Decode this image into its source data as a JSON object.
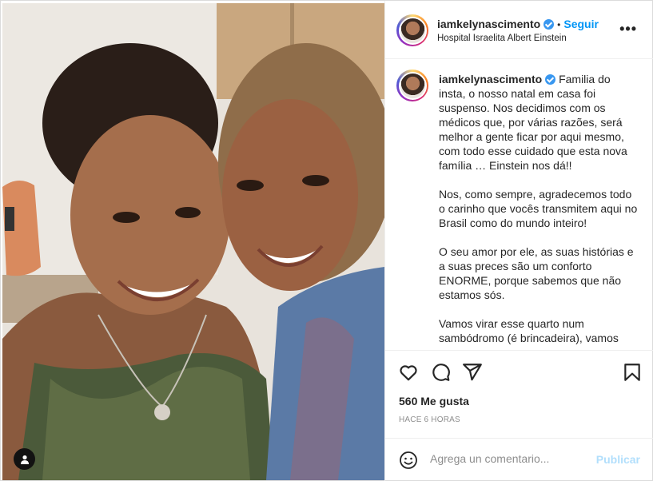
{
  "post": {
    "username": "iamkelynascimento",
    "follow_label": "Seguir",
    "separator": "•",
    "location": "Hospital Israelita Albert Einstein",
    "more_label": "•••",
    "caption": {
      "username": "iamkelynascimento",
      "paragraphs": [
        "Familia do insta, o nosso natal em casa foi suspenso. Nos decidimos com os médicos que, por várias razões, será melhor a gente ficar por aqui mesmo, com todo esse cuidado que esta nova família … Einstein nos dá!!",
        "Nos, como sempre, agradecemos todo o carinho que vocês transmitem aqui no Brasil como do mundo inteiro!",
        "O seu amor por ele, as suas histórias e a suas preces são um conforto ENORME, porque sabemos que não estamos sós.",
        "Vamos virar esse quarto num sambódromo (é brincadeira), vamos"
      ]
    },
    "likes": "560 Me gusta",
    "timestamp": "HACE 6 HORAS",
    "comment_placeholder": "Agrega un comentario...",
    "publish_label": "Publicar"
  },
  "colors": {
    "accent": "#0095f6",
    "publish_disabled": "#b2dffc",
    "verified": "#3897f0"
  },
  "icons": [
    "verified-icon",
    "more-icon",
    "heart-icon",
    "comment-icon",
    "share-icon",
    "bookmark-icon",
    "emoji-icon",
    "user-tag-icon"
  ]
}
